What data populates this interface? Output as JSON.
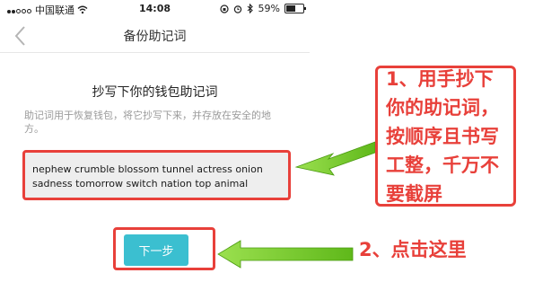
{
  "statusbar": {
    "carrier": "中国联通",
    "time": "14:08",
    "battery_text": "59%",
    "battery_level": 0.59
  },
  "navbar": {
    "title": "备份助记词"
  },
  "main": {
    "heading": "抄写下你的钱包助记词",
    "description": "助记词用于恢复钱包，将它抄写下来，并存放在安全的地方。",
    "mnemonic": "nephew crumble blossom tunnel actress onion sadness tomorrow switch nation top animal",
    "next_button": "下一步"
  },
  "annotations": {
    "step1_lines": [
      "1、用手抄下",
      "你的助记词，",
      "按顺序且书写",
      "工整，千万不",
      "要截屏"
    ],
    "step2": "2、点击这里"
  },
  "colors": {
    "accent": "#3bbfd0",
    "annotation": "#e8403a",
    "arrow": "#7ed321"
  }
}
